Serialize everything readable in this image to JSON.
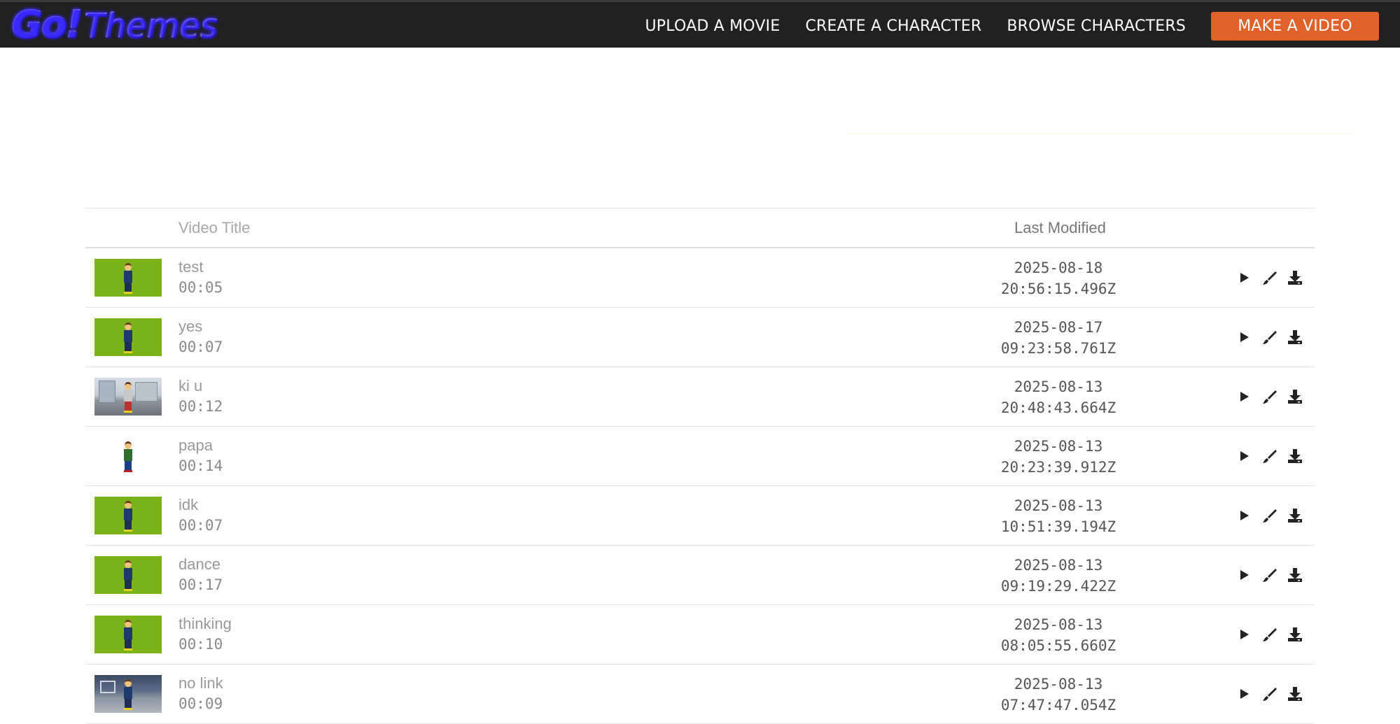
{
  "header": {
    "logo_part1": "Go!",
    "logo_part2": "Themes",
    "nav": [
      {
        "label": "UPLOAD A MOVIE"
      },
      {
        "label": "CREATE A CHARACTER"
      },
      {
        "label": "BROWSE CHARACTERS"
      }
    ],
    "cta_label": "MAKE A VIDEO",
    "cta_color": "#e0612a"
  },
  "table": {
    "col_title": "Video Title",
    "col_modified": "Last Modified",
    "rows": [
      {
        "title": "test",
        "duration": "00:05",
        "date": "2025-08-18",
        "time": "20:56:15.496Z",
        "thumb": "green"
      },
      {
        "title": "yes",
        "duration": "00:07",
        "date": "2025-08-17",
        "time": "09:23:58.761Z",
        "thumb": "green"
      },
      {
        "title": "ki u",
        "duration": "00:12",
        "date": "2025-08-13",
        "time": "20:48:43.664Z",
        "thumb": "street"
      },
      {
        "title": "papa",
        "duration": "00:14",
        "date": "2025-08-13",
        "time": "20:23:39.912Z",
        "thumb": "white"
      },
      {
        "title": "idk",
        "duration": "00:07",
        "date": "2025-08-13",
        "time": "10:51:39.194Z",
        "thumb": "green"
      },
      {
        "title": "dance",
        "duration": "00:17",
        "date": "2025-08-13",
        "time": "09:19:29.422Z",
        "thumb": "green"
      },
      {
        "title": "thinking",
        "duration": "00:10",
        "date": "2025-08-13",
        "time": "08:05:55.660Z",
        "thumb": "green"
      },
      {
        "title": "no link",
        "duration": "00:09",
        "date": "2025-08-13",
        "time": "07:47:47.054Z",
        "thumb": "court"
      }
    ],
    "row_actions": [
      "play-icon",
      "edit-brush-icon",
      "download-icon"
    ]
  }
}
